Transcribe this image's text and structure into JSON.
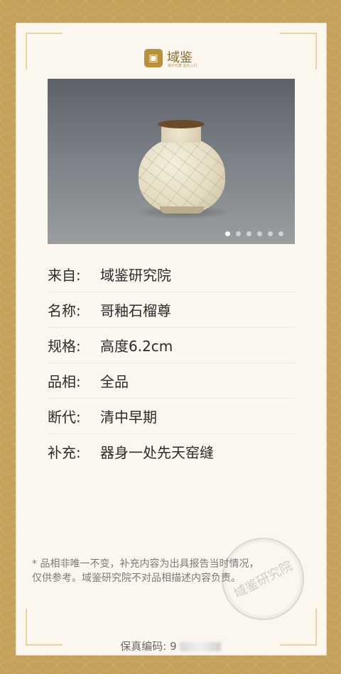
{
  "brand": {
    "name": "域鉴",
    "slogan": "域外珍藏 鉴别入行"
  },
  "gallery": {
    "total_images": 6,
    "active_index": 0
  },
  "details": [
    {
      "label": "来自:",
      "value": "域鉴研究院"
    },
    {
      "label": "名称:",
      "value": "哥釉石榴尊"
    },
    {
      "label": "规格:",
      "value": "高度6.2cm"
    },
    {
      "label": "品相:",
      "value": "全品"
    },
    {
      "label": "断代:",
      "value": "清中早期"
    },
    {
      "label": "补充:",
      "value": "器身一处先天窑缝"
    }
  ],
  "stamp_text": "域鉴研究院",
  "note": "* 品相非唯一不变，补充内容为出具报告当时情况，\n    仅供参考。域鉴研究院不对品相描述内容负责。",
  "certificate": {
    "label": "保真编码:",
    "code_visible": "9"
  },
  "colors": {
    "frame_gold": "#c6a15a",
    "card_bg": "#fbf7ef",
    "text": "#2b2b2b",
    "brand": "#b8913d"
  }
}
